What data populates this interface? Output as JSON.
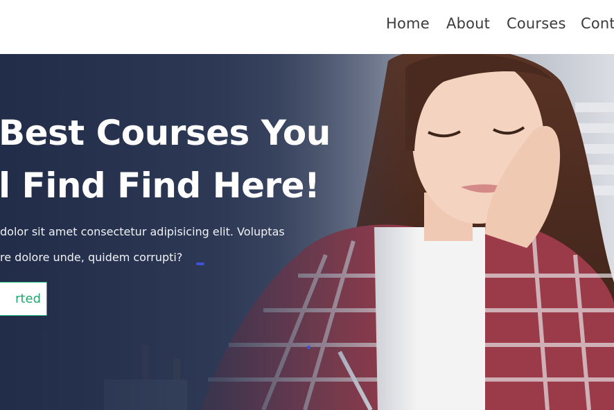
{
  "nav": {
    "items": [
      "Home",
      "About",
      "Courses",
      "Cont"
    ]
  },
  "hero": {
    "title_lines": [
      " Best Courses You",
      "l Find Find Here!"
    ],
    "text_lines": [
      " dolor sit amet consectetur adipisicing elit. Voluptas",
      "re dolore unde, quidem corrupti?"
    ],
    "cta_label": "rted"
  },
  "colors": {
    "accent": "#21b97a",
    "hero_overlay": "#2a3553",
    "nav_text": "#3b3b3b"
  },
  "icons": {
    "photo": "girl-studying-photo"
  }
}
